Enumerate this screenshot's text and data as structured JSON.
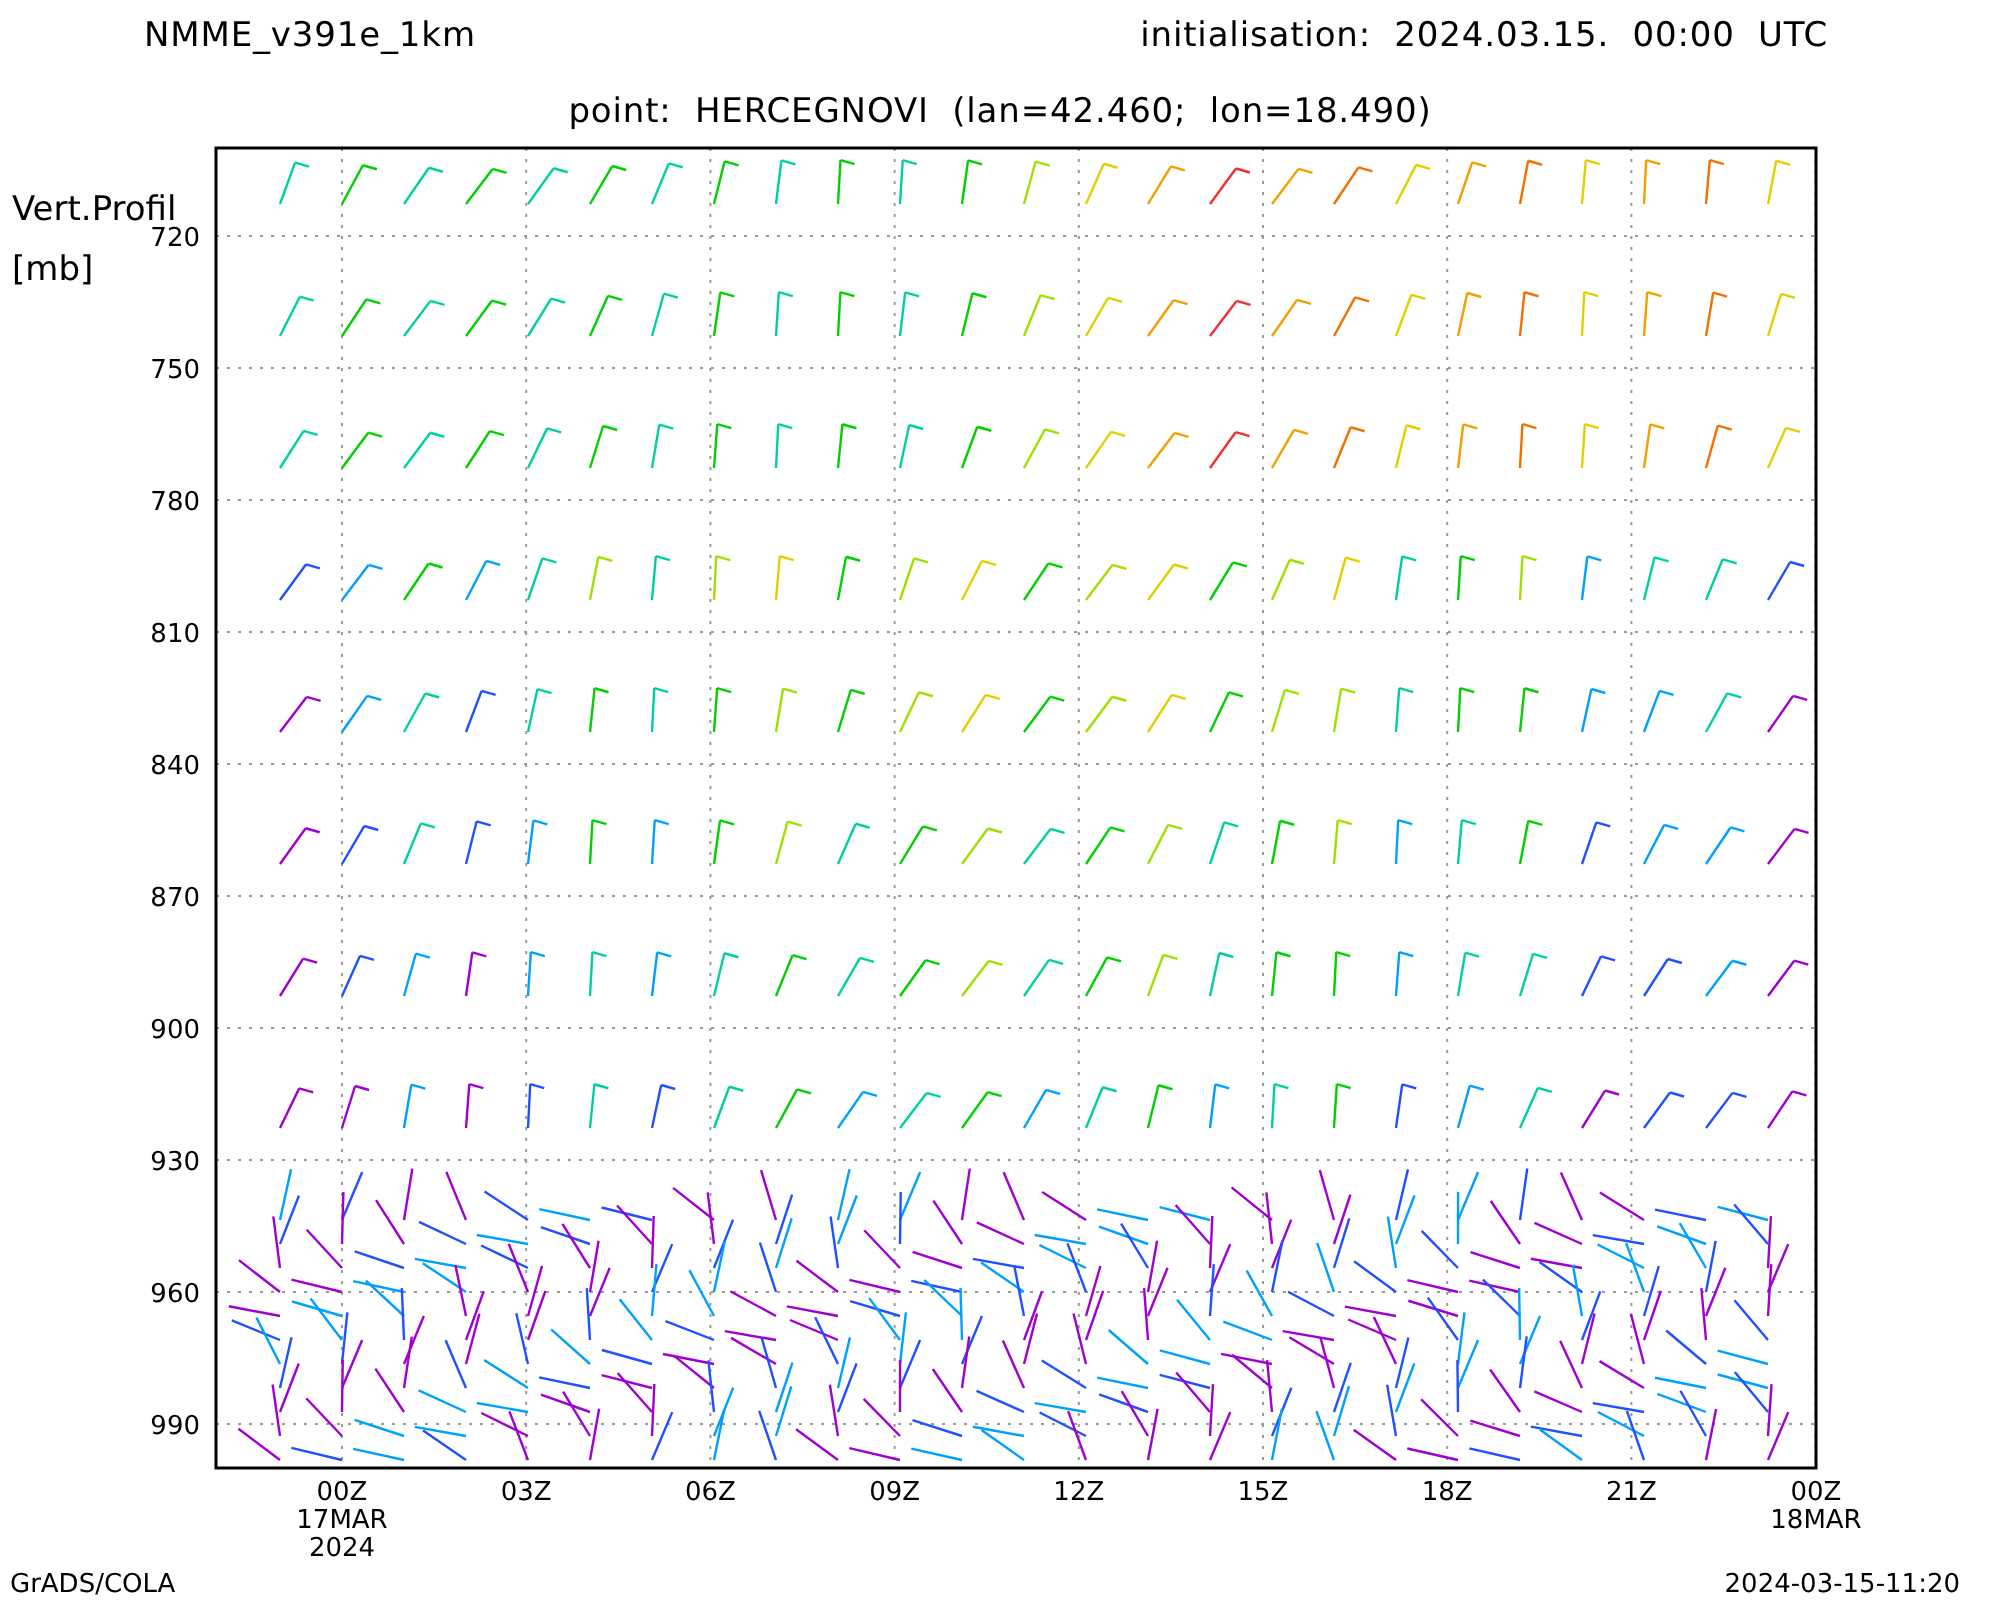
{
  "header": {
    "model": "NMME_v391e_1km",
    "initialisation": "initialisation:  2024.03.15.  00:00  UTC"
  },
  "title": "point:  HERCEGNOVI  (lan=42.460;  lon=18.490)",
  "y_axis": {
    "title": "Vert.Profil",
    "unit": "[mb]",
    "ticks": [
      "720",
      "750",
      "780",
      "810",
      "840",
      "870",
      "900",
      "930",
      "960",
      "990"
    ]
  },
  "x_axis": {
    "ticks": [
      {
        "lines": [
          "00Z",
          "17MAR",
          "2024"
        ]
      },
      {
        "lines": [
          "03Z"
        ]
      },
      {
        "lines": [
          "06Z"
        ]
      },
      {
        "lines": [
          "09Z"
        ]
      },
      {
        "lines": [
          "12Z"
        ]
      },
      {
        "lines": [
          "15Z"
        ]
      },
      {
        "lines": [
          "18Z"
        ]
      },
      {
        "lines": [
          "21Z"
        ]
      },
      {
        "lines": [
          "00Z",
          "18MAR"
        ]
      }
    ]
  },
  "footer": {
    "left": "GrADS/COLA",
    "right": "2024-03-15-11:20"
  }
}
